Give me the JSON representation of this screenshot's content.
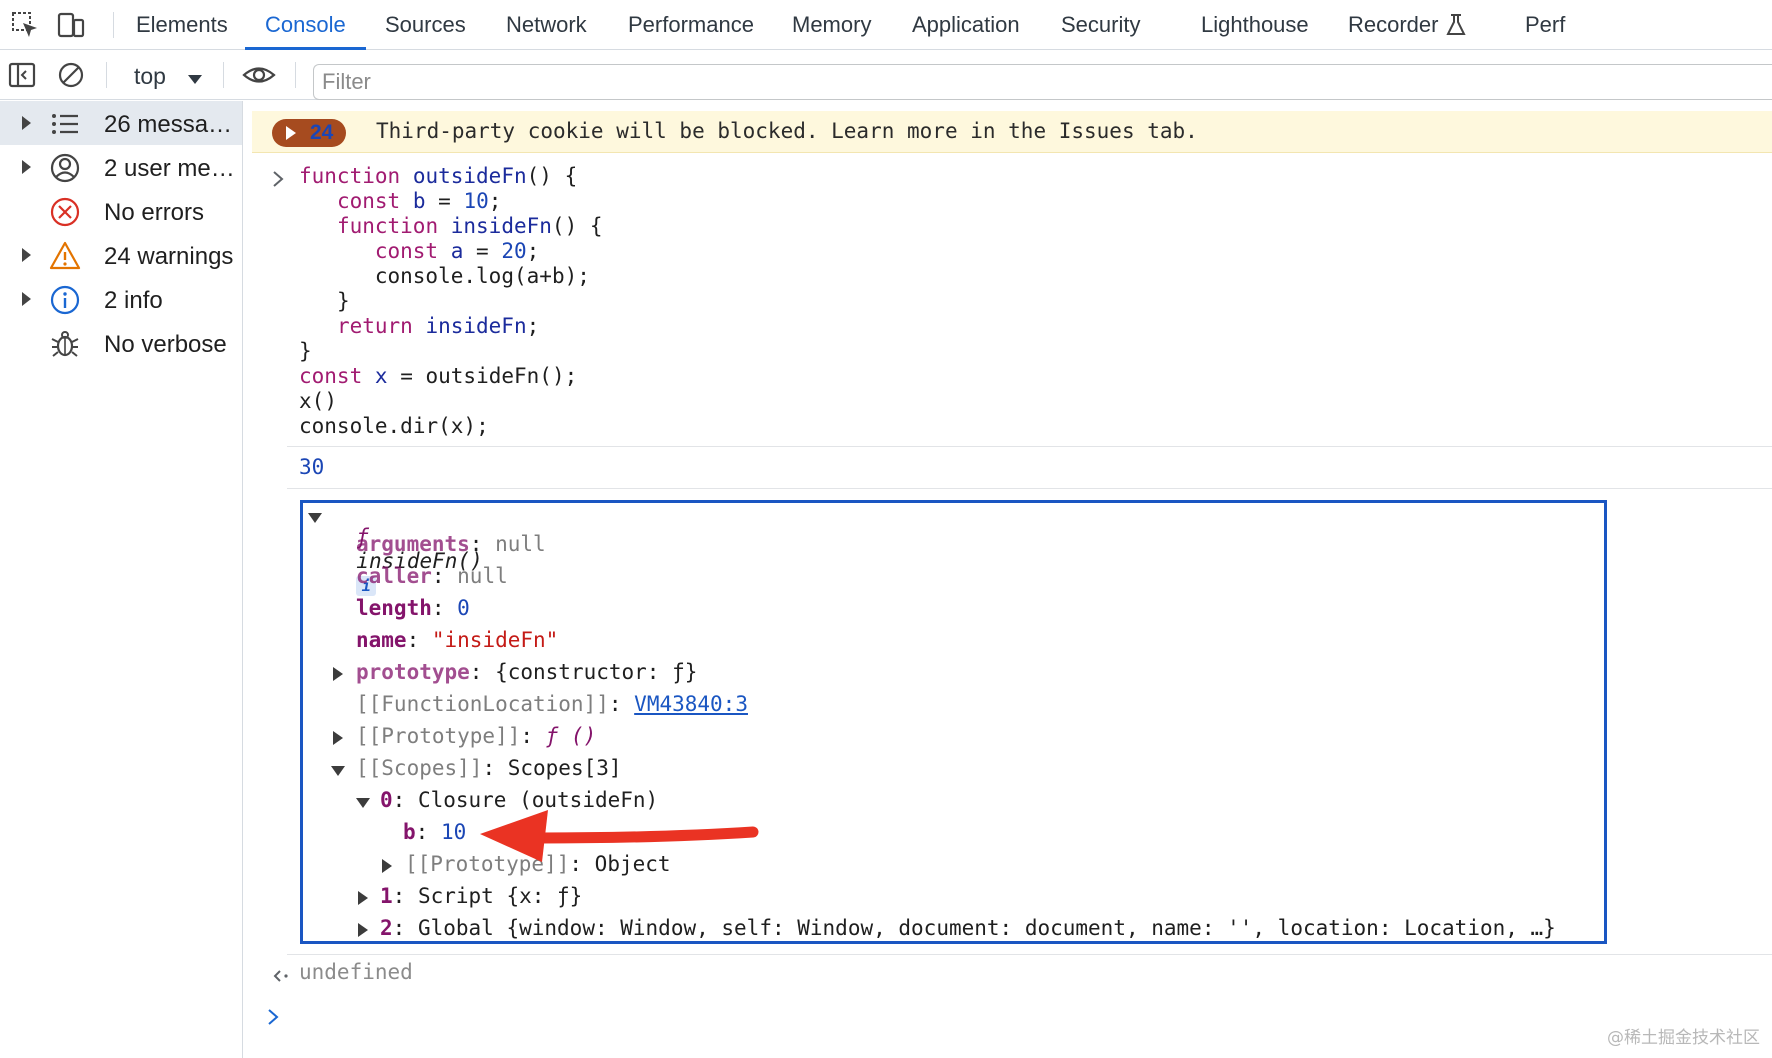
{
  "tabs": [
    "Elements",
    "Console",
    "Sources",
    "Network",
    "Performance",
    "Memory",
    "Application",
    "Security",
    "Lighthouse",
    "Recorder",
    "Perf"
  ],
  "toolbar": {
    "context": "top",
    "filter_placeholder": "Filter"
  },
  "sidebar": {
    "items": [
      {
        "label": "26 messa…",
        "icon": "list-icon"
      },
      {
        "label": "2 user me…",
        "icon": "user-icon"
      },
      {
        "label": "No errors",
        "icon": "error-icon"
      },
      {
        "label": "24 warnings",
        "icon": "warning-icon"
      },
      {
        "label": "2 info",
        "icon": "info-icon"
      },
      {
        "label": "No verbose",
        "icon": "bug-icon"
      }
    ]
  },
  "issue": {
    "count": "24",
    "text": "Third-party cookie will be blocked. Learn more in the Issues tab."
  },
  "code_lines": [
    "function outsideFn() {",
    "   const b = 10;",
    "   function insideFn() {",
    "      const a = 20;",
    "      console.log(a+b);",
    "   }",
    "   return insideFn;",
    "}",
    "const x = outsideFn();",
    "x()",
    "console.dir(x);"
  ],
  "output_value": "30",
  "object": {
    "header_f": "ƒ",
    "header_name": "insideFn()",
    "badge": "i",
    "props": {
      "arguments_key": "arguments",
      "arguments_val": "null",
      "caller_key": "caller",
      "caller_val": "null",
      "length_key": "length",
      "length_val": "0",
      "name_key": "name",
      "name_val": "\"insideFn\"",
      "prototype_key": "prototype",
      "prototype_val": "{constructor: ƒ}",
      "funcloc_key": "[[FunctionLocation]]",
      "funcloc_val": "VM43840:3",
      "proto_key": "[[Prototype]]",
      "proto_val": "ƒ ()",
      "scopes_key": "[[Scopes]]",
      "scopes_val": "Scopes[3]",
      "scope0": "Closure (outsideFn)",
      "b_key": "b",
      "b_val": "10",
      "scope0_proto_key": "[[Prototype]]",
      "scope0_proto_val": "Object",
      "scope1": "Script {x: ƒ}",
      "scope2": "Global {window: Window, self: Window, document: document, name: '', location: Location, …}"
    }
  },
  "return_value": "undefined",
  "watermark": "@稀土掘金技术社区",
  "colors": {
    "accent": "#1a67d2",
    "annotation_arrow": "#ea3323",
    "box_border": "#1a56c2"
  }
}
